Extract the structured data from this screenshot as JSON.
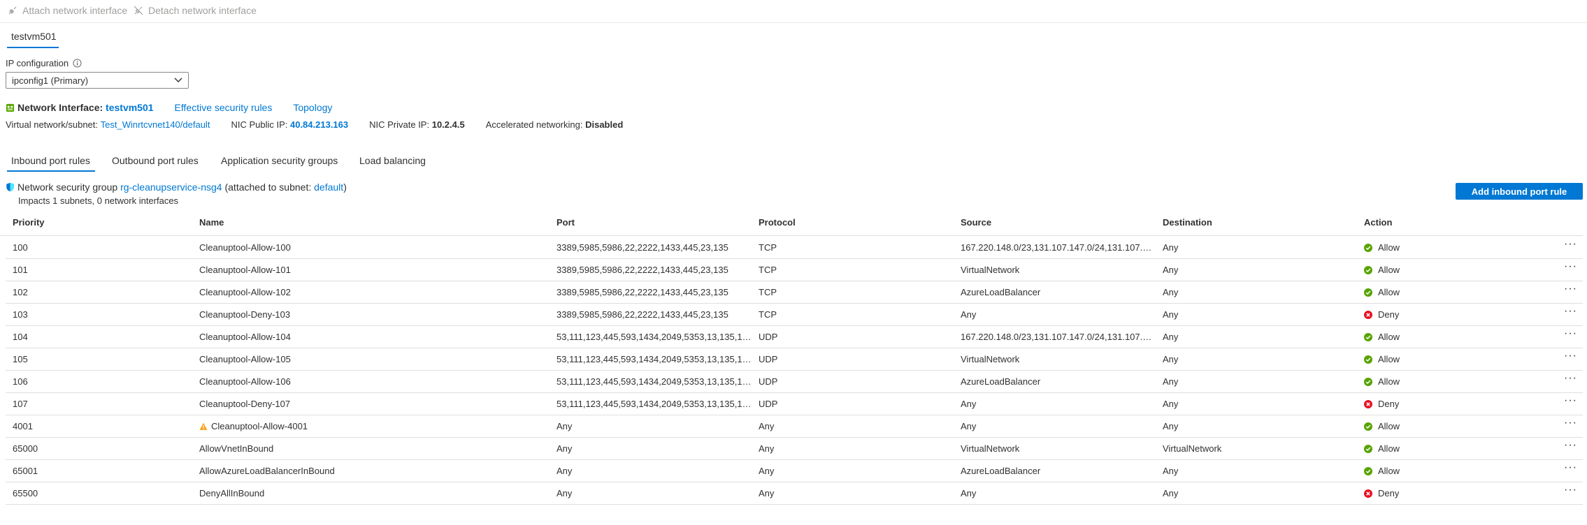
{
  "toolbar": {
    "attach_label": "Attach network interface",
    "detach_label": "Detach network interface"
  },
  "vm_tab": "testvm501",
  "ip_config": {
    "label": "IP configuration",
    "selected": "ipconfig1 (Primary)"
  },
  "nic": {
    "prefix": "Network Interface:",
    "name": "testvm501",
    "effective_rules_link": "Effective security rules",
    "topology_link": "Topology",
    "vnet_label": "Virtual network/subnet:",
    "vnet_value": "Test_Winrtcvnet140/default",
    "public_ip_label": "NIC Public IP:",
    "public_ip_value": "40.84.213.163",
    "private_ip_label": "NIC Private IP:",
    "private_ip_value": "10.2.4.5",
    "accel_label": "Accelerated networking:",
    "accel_value": "Disabled"
  },
  "tabs": [
    "Inbound port rules",
    "Outbound port rules",
    "Application security groups",
    "Load balancing"
  ],
  "nsg": {
    "prefix": "Network security group",
    "name": "rg-cleanupservice-nsg4",
    "attached_prefix": "(attached to subnet:",
    "subnet": "default",
    "attached_suffix": ")",
    "impacts": "Impacts 1 subnets, 0 network interfaces"
  },
  "add_button": "Add inbound port rule",
  "columns": [
    "Priority",
    "Name",
    "Port",
    "Protocol",
    "Source",
    "Destination",
    "Action"
  ],
  "rows": [
    {
      "priority": "100",
      "name": "Cleanuptool-Allow-100",
      "warn": false,
      "port": "3389,5985,5986,22,2222,1433,445,23,135",
      "protocol": "TCP",
      "source": "167.220.148.0/23,131.107.147.0/24,131.107.15...",
      "destination": "Any",
      "action": "Allow"
    },
    {
      "priority": "101",
      "name": "Cleanuptool-Allow-101",
      "warn": false,
      "port": "3389,5985,5986,22,2222,1433,445,23,135",
      "protocol": "TCP",
      "source": "VirtualNetwork",
      "destination": "Any",
      "action": "Allow"
    },
    {
      "priority": "102",
      "name": "Cleanuptool-Allow-102",
      "warn": false,
      "port": "3389,5985,5986,22,2222,1433,445,23,135",
      "protocol": "TCP",
      "source": "AzureLoadBalancer",
      "destination": "Any",
      "action": "Allow"
    },
    {
      "priority": "103",
      "name": "Cleanuptool-Deny-103",
      "warn": false,
      "port": "3389,5985,5986,22,2222,1433,445,23,135",
      "protocol": "TCP",
      "source": "Any",
      "destination": "Any",
      "action": "Deny"
    },
    {
      "priority": "104",
      "name": "Cleanuptool-Allow-104",
      "warn": false,
      "port": "53,111,123,445,593,1434,2049,5353,13,135,136...",
      "protocol": "UDP",
      "source": "167.220.148.0/23,131.107.147.0/24,131.107.15...",
      "destination": "Any",
      "action": "Allow"
    },
    {
      "priority": "105",
      "name": "Cleanuptool-Allow-105",
      "warn": false,
      "port": "53,111,123,445,593,1434,2049,5353,13,135,136...",
      "protocol": "UDP",
      "source": "VirtualNetwork",
      "destination": "Any",
      "action": "Allow"
    },
    {
      "priority": "106",
      "name": "Cleanuptool-Allow-106",
      "warn": false,
      "port": "53,111,123,445,593,1434,2049,5353,13,135,136...",
      "protocol": "UDP",
      "source": "AzureLoadBalancer",
      "destination": "Any",
      "action": "Allow"
    },
    {
      "priority": "107",
      "name": "Cleanuptool-Deny-107",
      "warn": false,
      "port": "53,111,123,445,593,1434,2049,5353,13,135,136...",
      "protocol": "UDP",
      "source": "Any",
      "destination": "Any",
      "action": "Deny"
    },
    {
      "priority": "4001",
      "name": "Cleanuptool-Allow-4001",
      "warn": true,
      "port": "Any",
      "protocol": "Any",
      "source": "Any",
      "destination": "Any",
      "action": "Allow"
    },
    {
      "priority": "65000",
      "name": "AllowVnetInBound",
      "warn": false,
      "port": "Any",
      "protocol": "Any",
      "source": "VirtualNetwork",
      "destination": "VirtualNetwork",
      "action": "Allow"
    },
    {
      "priority": "65001",
      "name": "AllowAzureLoadBalancerInBound",
      "warn": false,
      "port": "Any",
      "protocol": "Any",
      "source": "AzureLoadBalancer",
      "destination": "Any",
      "action": "Allow"
    },
    {
      "priority": "65500",
      "name": "DenyAllInBound",
      "warn": false,
      "port": "Any",
      "protocol": "Any",
      "source": "Any",
      "destination": "Any",
      "action": "Deny"
    }
  ],
  "colors": {
    "accent": "#0078d4",
    "allow": "#57a300",
    "deny": "#e81123",
    "warn": "#f7a521"
  },
  "more_glyph": "···"
}
